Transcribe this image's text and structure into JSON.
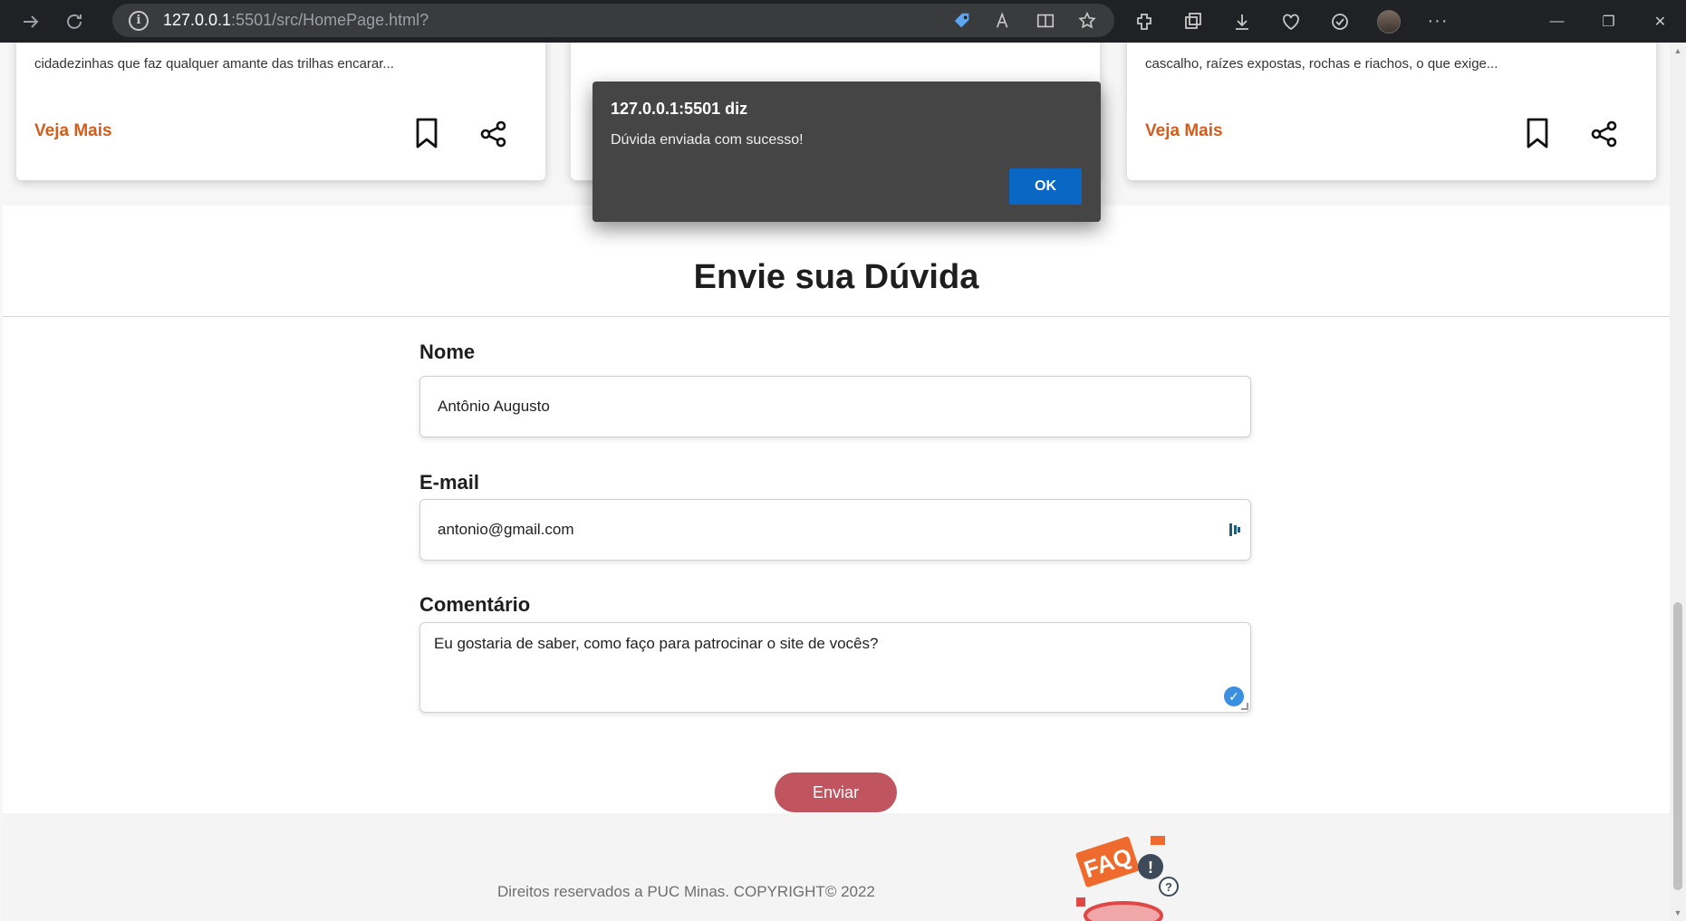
{
  "browser": {
    "url_host": "127.0.0.1",
    "url_rest": ":5501/src/HomePage.html?"
  },
  "cards": [
    {
      "text": "cidadezinhas que faz qualquer amante das trilhas encarar...",
      "link_label": "Veja Mais"
    },
    {
      "text": "",
      "link_label": ""
    },
    {
      "text": "cascalho, raízes expostas, rochas e riachos, o que exige...",
      "link_label": "Veja Mais"
    }
  ],
  "form": {
    "title": "Envie sua Dúvida",
    "name_label": "Nome",
    "name_value": "Antônio Augusto",
    "email_label": "E-mail",
    "email_value": "antonio@gmail.com",
    "comment_label": "Comentário",
    "comment_value": "Eu gostaria de saber, como faço para patrocinar o site de vocês?",
    "submit_label": "Enviar"
  },
  "footer": {
    "copyright": "Direitos reservados a PUC Minas. COPYRIGHT© 2022",
    "faq_art_text": "FAQ"
  },
  "dialog": {
    "title": "127.0.0.1:5501 diz",
    "message": "Dúvida enviada com sucesso!",
    "ok_label": "OK"
  },
  "colors": {
    "accent_link": "#d35d1c",
    "submit_button": "#c0555f",
    "dialog_ok": "#0a67c3"
  }
}
